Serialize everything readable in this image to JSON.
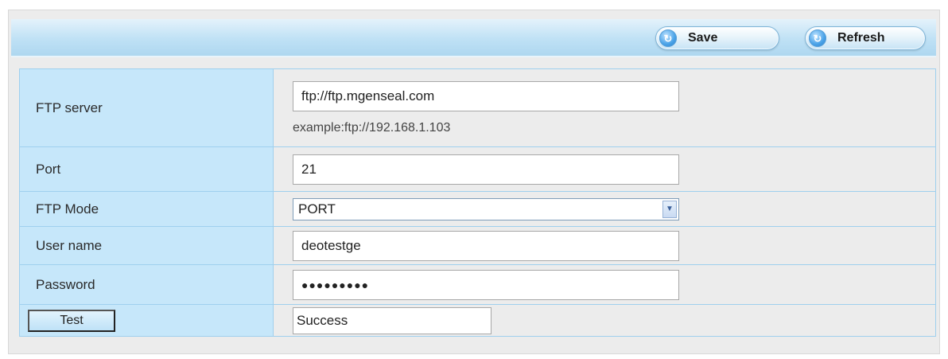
{
  "toolbar": {
    "save_label": "Save",
    "refresh_label": "Refresh"
  },
  "form": {
    "ftp_server": {
      "label": "FTP server",
      "value": "ftp://ftp.mgenseal.com",
      "hint": "example:ftp://192.168.1.103"
    },
    "port": {
      "label": "Port",
      "value": "21"
    },
    "ftp_mode": {
      "label": "FTP Mode",
      "selected": "PORT"
    },
    "username": {
      "label": "User name",
      "value": "deotestge"
    },
    "password": {
      "label": "Password",
      "value": "●●●●●●●●●"
    },
    "test": {
      "button_label": "Test",
      "result": "Success"
    }
  },
  "colors": {
    "toolbar_top": "#e4f2fb",
    "toolbar_bottom": "#aed7f0",
    "label_cell": "#c6e7fa",
    "value_cell": "#ececec",
    "cell_border": "#9fd0ee"
  },
  "icons": {
    "save": "refresh-circle-icon",
    "refresh": "refresh-circle-icon",
    "select_arrow": "chevron-down-icon"
  }
}
